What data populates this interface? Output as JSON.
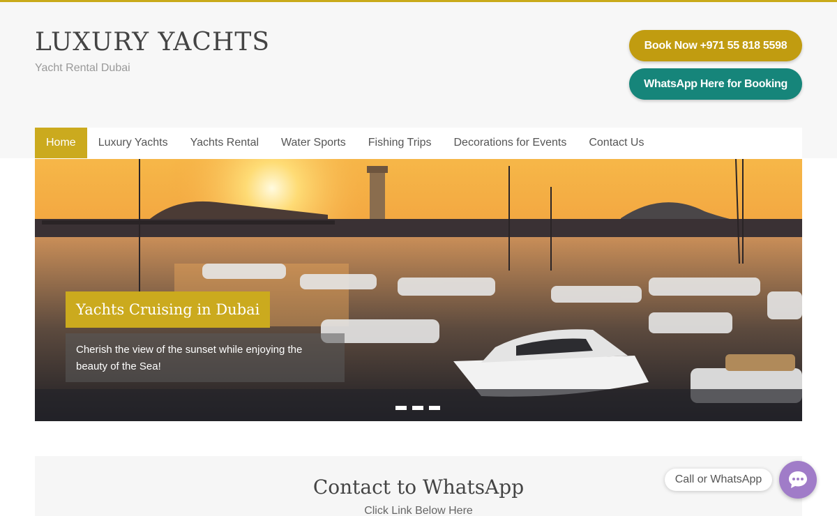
{
  "header": {
    "site_title": "LUXURY YACHTS",
    "tagline": "Yacht Rental Dubai",
    "book_button": "Book Now +971 55 818 5598",
    "whatsapp_button": "WhatsApp Here for Booking"
  },
  "nav": {
    "items": [
      {
        "label": "Home",
        "active": true
      },
      {
        "label": "Luxury Yachts"
      },
      {
        "label": "Yachts Rental"
      },
      {
        "label": "Water Sports"
      },
      {
        "label": "Fishing Trips"
      },
      {
        "label": "Decorations for Events"
      },
      {
        "label": "Contact Us"
      }
    ]
  },
  "slider": {
    "caption_title": "Yachts Cruising in Dubai",
    "caption_text": "Cherish the view of the sunset while enjoying the beauty of the Sea!",
    "slide_count": 3
  },
  "contact": {
    "title": "Contact to WhatsApp",
    "subtitle": "Click Link Below Here"
  },
  "floating": {
    "call_label": "Call or WhatsApp",
    "chat_icon": "chat-bubble-icon"
  },
  "colors": {
    "accent_gold": "#cbaa1e",
    "book_button": "#c19c10",
    "whatsapp_button": "#16857a",
    "chat_button": "#a07cc8"
  }
}
